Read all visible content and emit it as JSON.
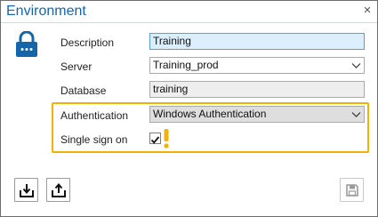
{
  "window": {
    "title": "Environment",
    "close_glyph": "×"
  },
  "icons": {
    "lock": "lock-icon",
    "close": "close-icon",
    "import": "import-icon",
    "export": "export-icon",
    "save": "save-icon",
    "warning": "warning-icon",
    "dropdown": "chevron-down-icon",
    "check": "checkmark-icon"
  },
  "form": {
    "description": {
      "label": "Description",
      "value": "Training"
    },
    "server": {
      "label": "Server",
      "value": "Training_prod"
    },
    "database": {
      "label": "Database",
      "value": "training"
    },
    "authentication": {
      "label": "Authentication",
      "value": "Windows Authentication"
    },
    "sso": {
      "label": "Single sign on",
      "checked": true
    }
  },
  "colors": {
    "accent": "#1565a8",
    "highlight_border": "#f0b400",
    "warning": "#f2b200",
    "focus_border": "#4ca3e0"
  }
}
